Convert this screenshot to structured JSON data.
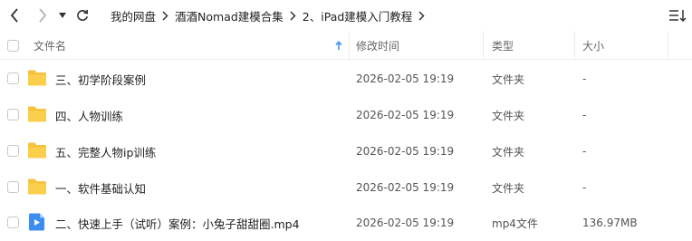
{
  "breadcrumb": [
    "我的网盘",
    "酒酒Nomad建模合集",
    "2、iPad建模入门教程"
  ],
  "header": {
    "name": "文件名",
    "modified": "修改时间",
    "type": "类型",
    "size": "大小"
  },
  "rows": [
    {
      "name": "三、初学阶段案例",
      "modified": "2026-02-05 19:19",
      "type": "文件夹",
      "size": "-",
      "icon": "folder-icon"
    },
    {
      "name": "四、人物训练",
      "modified": "2026-02-05 19:19",
      "type": "文件夹",
      "size": "-",
      "icon": "folder-icon"
    },
    {
      "name": "五、完整人物ip训练",
      "modified": "2026-02-05 19:19",
      "type": "文件夹",
      "size": "-",
      "icon": "folder-icon"
    },
    {
      "name": "一、软件基础认知",
      "modified": "2026-02-05 19:19",
      "type": "文件夹",
      "size": "-",
      "icon": "folder-icon"
    },
    {
      "name": "二、快速上手（试听）案例：小兔子甜甜圈.mp4",
      "modified": "2026-02-05 19:19",
      "type": "mp4文件",
      "size": "136.97MB",
      "icon": "video-file-icon"
    }
  ],
  "colors": {
    "accent": "#3b8ef0",
    "folder": "#f7c23c"
  }
}
